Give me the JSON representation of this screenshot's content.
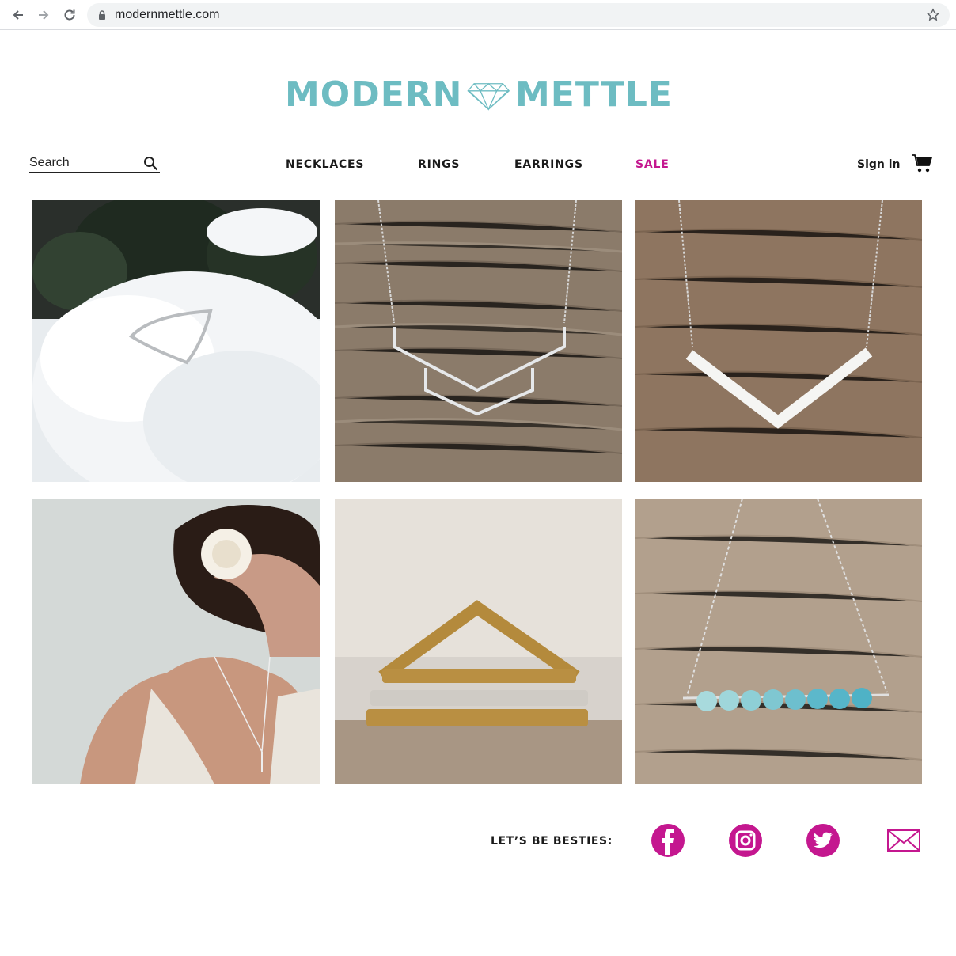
{
  "browser": {
    "url": "modernmettle.com"
  },
  "brand": {
    "word_left": "MODERN",
    "word_right": "METTLE",
    "logo_color": "#6dbcc2"
  },
  "search": {
    "placeholder": "Search"
  },
  "nav": {
    "necklaces": "NECKLACES",
    "rings": "RINGS",
    "earrings": "EARRINGS",
    "sale": "SALE",
    "sale_color": "#c4178f"
  },
  "account": {
    "signin": "Sign in"
  },
  "products": [
    {
      "icon": "chevron-ring-on-snow-image"
    },
    {
      "icon": "double-chevron-necklace-image"
    },
    {
      "icon": "v-bar-necklace-image"
    },
    {
      "icon": "bride-wearing-jewelry-image"
    },
    {
      "icon": "stacked-rings-image"
    },
    {
      "icon": "aqua-bead-bar-necklace-image"
    }
  ],
  "footer": {
    "besties": "LET’S BE BESTIES:",
    "social_color": "#c4178f",
    "icons": [
      "facebook-icon",
      "instagram-icon",
      "twitter-icon",
      "mail-icon"
    ]
  }
}
